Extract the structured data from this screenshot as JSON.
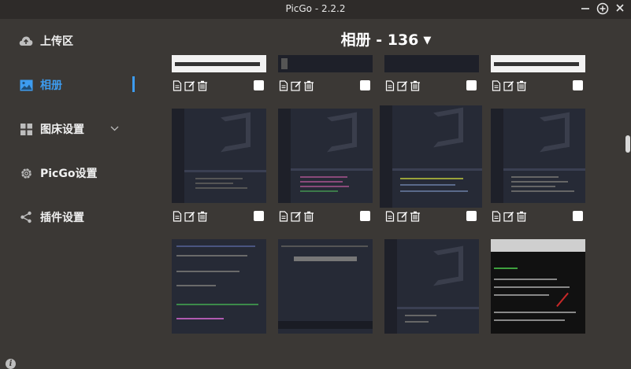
{
  "window": {
    "title": "PicGo - 2.2.2"
  },
  "sidebar": {
    "items": [
      {
        "label": "上传区",
        "icon": "cloud-upload-icon"
      },
      {
        "label": "相册",
        "icon": "image-icon",
        "active": true
      },
      {
        "label": "图床设置",
        "icon": "grid-icon"
      },
      {
        "label": "PicGo设置",
        "icon": "gear-icon"
      },
      {
        "label": "插件设置",
        "icon": "share-icon"
      }
    ]
  },
  "header": {
    "title": "相册 - 136"
  },
  "colors": {
    "accent": "#3d9cf0",
    "background": "#3b3835",
    "titlebar": "#2e2b29"
  }
}
